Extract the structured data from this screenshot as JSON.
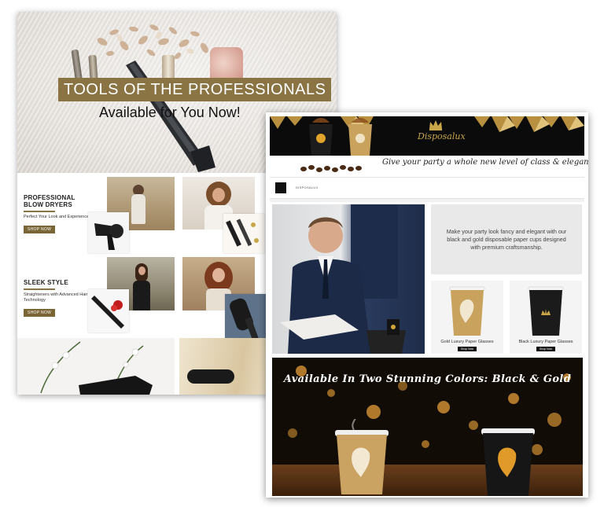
{
  "left_page": {
    "hero": {
      "headline": "TOOLS OF THE PROFESSIONALS",
      "subheadline": "Available for You Now!"
    },
    "products": [
      {
        "title_line1": "PROFESSIONAL",
        "title_line2": "BLOW DRYERS",
        "description": "Perfect Your Look and Experience",
        "button": "SHOP NOW"
      },
      {
        "title_line1": "SLEEK STYLE",
        "title_line2": "",
        "description": "Straighteners with Advanced Hair Care Technology",
        "button": "SHOP NOW"
      }
    ],
    "accent_color": "#8a7444"
  },
  "right_page": {
    "brand": "Disposalux",
    "tagline": "Give your party a whole new level of class & elegance",
    "nav_text": "DISPOSALUX",
    "info_text": "Make your party look fancy and elegant with our black and gold disposable paper cups designed with premium craftsmanship.",
    "cups": [
      {
        "label": "Gold Luxury Paper Glasses",
        "button": "Shop Now"
      },
      {
        "label": "Black Luxury Paper Glasses",
        "button": "Shop Now"
      }
    ],
    "bottom_title": "Available In Two Stunning Colors: Black & Gold",
    "gold_color": "#c9a64a"
  }
}
